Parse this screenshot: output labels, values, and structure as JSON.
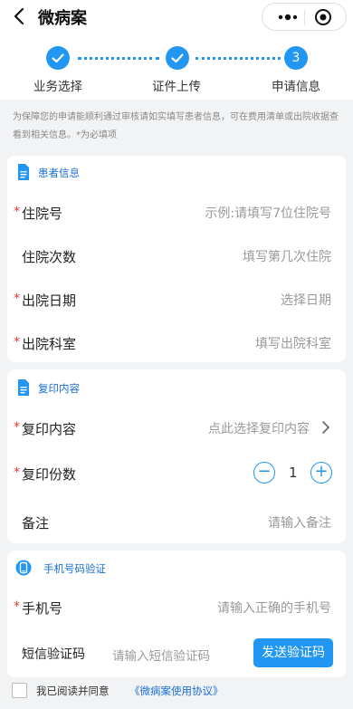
{
  "nav": {
    "title": "微病案"
  },
  "steps": [
    {
      "label": "业务选择",
      "state": "done"
    },
    {
      "label": "证件上传",
      "state": "done"
    },
    {
      "label": "申请信息",
      "state": "active",
      "number": "3"
    }
  ],
  "notice": "为保障您的申请能顺利通过审核请如实填写患者信息，可在费用清单或出院收据查看到相关信息。*为必填项",
  "patient": {
    "title": "患者信息",
    "fields": [
      {
        "label": "住院号",
        "required": "*",
        "placeholder": "示例:请填写7位住院号"
      },
      {
        "label": "住院次数",
        "required": "",
        "placeholder": "填写第几次住院"
      },
      {
        "label": "出院日期",
        "required": "*",
        "placeholder": "选择日期"
      },
      {
        "label": "出院科室",
        "required": "*",
        "placeholder": "填写出院科室"
      }
    ]
  },
  "copy": {
    "title": "复印内容",
    "content_label": "复印内容",
    "content_placeholder": "点此选择复印内容",
    "count_label": "复印份数",
    "count_value": "1",
    "minus": "−",
    "plus": "+",
    "note_label": "备注",
    "note_placeholder": "请输入备注",
    "required": "*"
  },
  "phone": {
    "title": "手机号码验证",
    "phone_label": "手机号",
    "phone_placeholder": "请输入正确的手机号",
    "code_label": "短信验证码",
    "code_placeholder": "请输入短信验证码",
    "send_button": "发送验证码",
    "required": "*"
  },
  "agreement": {
    "text": "我已阅读并同意",
    "link": "《微病案使用协议》"
  },
  "colors": {
    "accent": "#2196f3",
    "required": "#e53935",
    "link": "#1a6fd6"
  }
}
